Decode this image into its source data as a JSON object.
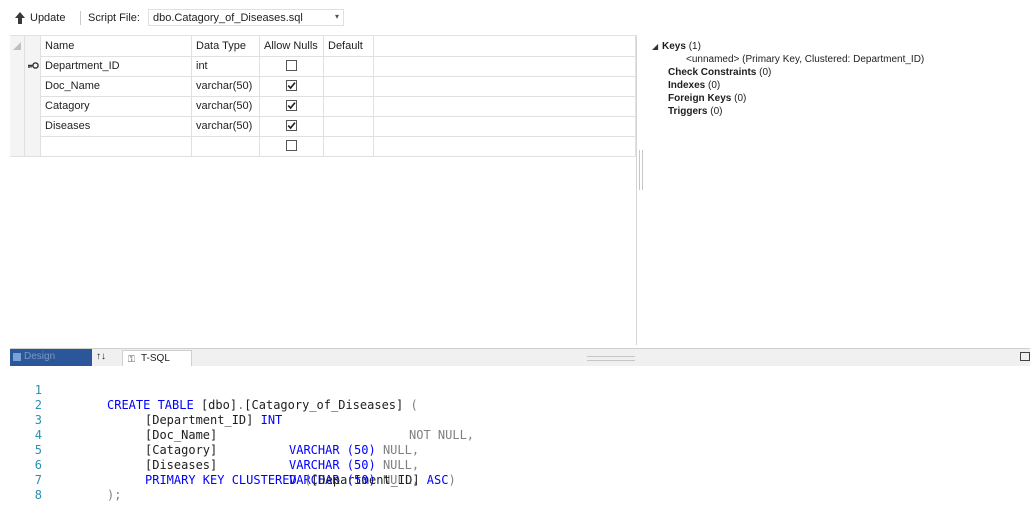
{
  "toolbar": {
    "update_label": "Update",
    "script_file_label": "Script File:",
    "script_file_value": "dbo.Catagory_of_Diseases.sql"
  },
  "grid": {
    "headers": [
      "Name",
      "Data Type",
      "Allow Nulls",
      "Default"
    ],
    "rows": [
      {
        "name": "Department_ID",
        "type": "int",
        "allow_nulls": false,
        "primary_key": true
      },
      {
        "name": "Doc_Name",
        "type": "varchar(50)",
        "allow_nulls": true,
        "primary_key": false
      },
      {
        "name": "Catagory",
        "type": "varchar(50)",
        "allow_nulls": true,
        "primary_key": false
      },
      {
        "name": "Diseases",
        "type": "varchar(50)",
        "allow_nulls": true,
        "primary_key": false
      },
      {
        "name": "",
        "type": "",
        "allow_nulls": false,
        "primary_key": false
      }
    ]
  },
  "properties": {
    "keys_label": "Keys",
    "keys_count": "(1)",
    "key_item": "<unnamed>   (Primary Key, Clustered: Department_ID)",
    "check_constraints_label": "Check Constraints",
    "check_constraints_count": "(0)",
    "indexes_label": "Indexes",
    "indexes_count": "(0)",
    "foreign_keys_label": "Foreign Keys",
    "foreign_keys_count": "(0)",
    "triggers_label": "Triggers",
    "triggers_count": "(0)"
  },
  "tabs": {
    "design_label": "Design",
    "swap_label": "↑↓",
    "tsql_label": "T-SQL"
  },
  "code": {
    "line_numbers": [
      "1",
      "2",
      "3",
      "4",
      "5",
      "6",
      "7",
      "8"
    ],
    "l1_kw": "CREATE TABLE",
    "l1_id": "[dbo]",
    "l1_dot": ".",
    "l1_id2": "[Catagory_of_Diseases]",
    "l1_paren": " (",
    "l2_id": "[Department_ID]",
    "l2_type": "INT",
    "l2_null": "NOT NULL,",
    "l3_id": "[Doc_Name]",
    "l3_type": "VARCHAR (50)",
    "l3_null": "NULL,",
    "l4_id": "[Catagory]",
    "l4_type": "VARCHAR (50)",
    "l4_null": "NULL,",
    "l5_id": "[Diseases]",
    "l5_type": "VARCHAR (50)",
    "l5_null": "NULL,",
    "l6_kw": "PRIMARY KEY CLUSTERED",
    "l6_open": " (",
    "l6_id": "[Department_ID]",
    "l6_asc": " ASC",
    "l6_close": ")",
    "l7": ");"
  },
  "colors": {
    "keyword": "#0000ff",
    "gray": "#808080",
    "line_number": "#2b91af",
    "design_tab": "#2b579a"
  }
}
